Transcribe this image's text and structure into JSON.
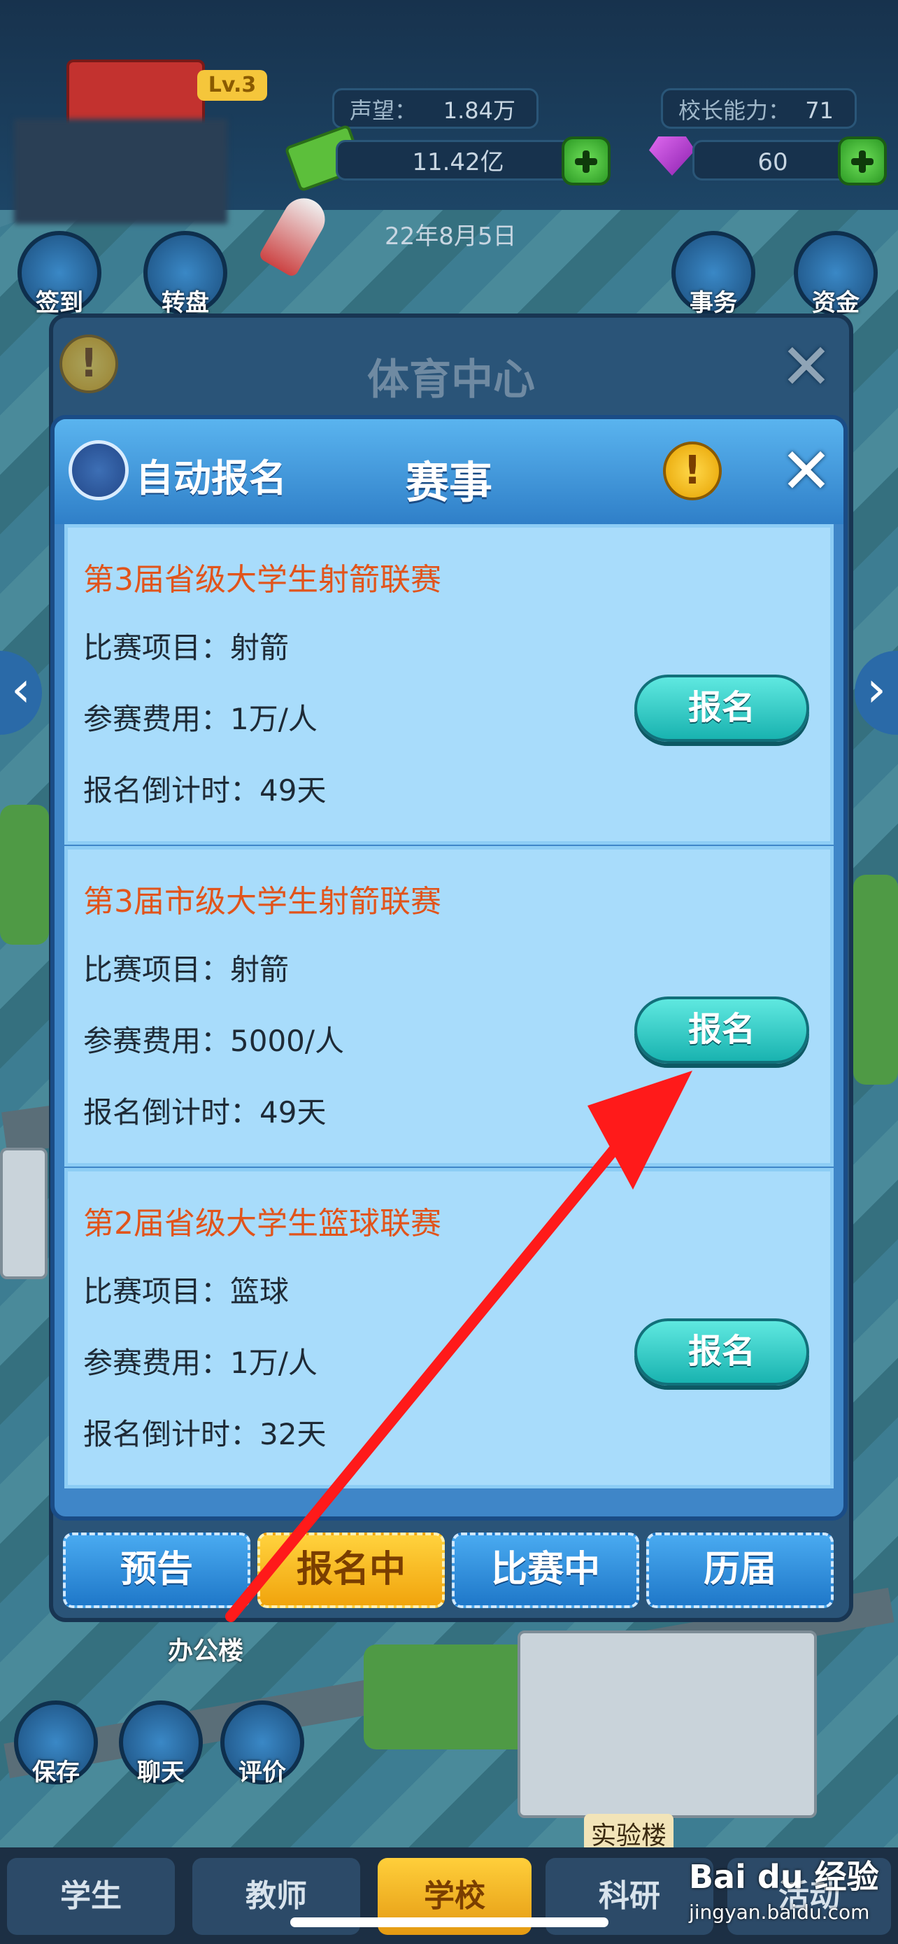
{
  "hud": {
    "level": "Lv.3",
    "reputation_label": "声望：",
    "reputation_value": "1.84万",
    "ability_label": "校长能力：",
    "ability_value": "71",
    "money": "11.42亿",
    "gems": "60",
    "date": "22年8月5日",
    "left_icons": [
      "签到",
      "转盘"
    ],
    "right_icons": [
      "事务",
      "资金"
    ]
  },
  "back_dialog": {
    "title": "体育中心"
  },
  "dialog": {
    "title": "赛事",
    "auto_signup_label": "自动报名",
    "events": [
      {
        "title": "第3届省级大学生射箭联赛",
        "sport": "比赛项目：射箭",
        "fee": "参赛费用：1万/人",
        "countdown": "报名倒计时：49天",
        "button": "报名"
      },
      {
        "title": "第3届市级大学生射箭联赛",
        "sport": "比赛项目：射箭",
        "fee": "参赛费用：5000/人",
        "countdown": "报名倒计时：49天",
        "button": "报名"
      },
      {
        "title": "第2届省级大学生篮球联赛",
        "sport": "比赛项目：篮球",
        "fee": "参赛费用：1万/人",
        "countdown": "报名倒计时：32天",
        "button": "报名"
      }
    ],
    "tabs": [
      "预告",
      "报名中",
      "比赛中",
      "历届"
    ],
    "active_tab": "报名中"
  },
  "tools": [
    "保存",
    "聊天",
    "评价"
  ],
  "bottom_nav": [
    "学生",
    "教师",
    "学校",
    "科研",
    "活动"
  ],
  "active_nav": "学校",
  "scene_labels": [
    "办公楼",
    "实验楼"
  ],
  "watermark": {
    "brand": "Bai du 经验",
    "url": "jingyan.baidu.com"
  },
  "colors": {
    "accent_orange": "#e1541b",
    "button_teal": "#19b3b0",
    "arrow_red": "#ff1a1a"
  }
}
